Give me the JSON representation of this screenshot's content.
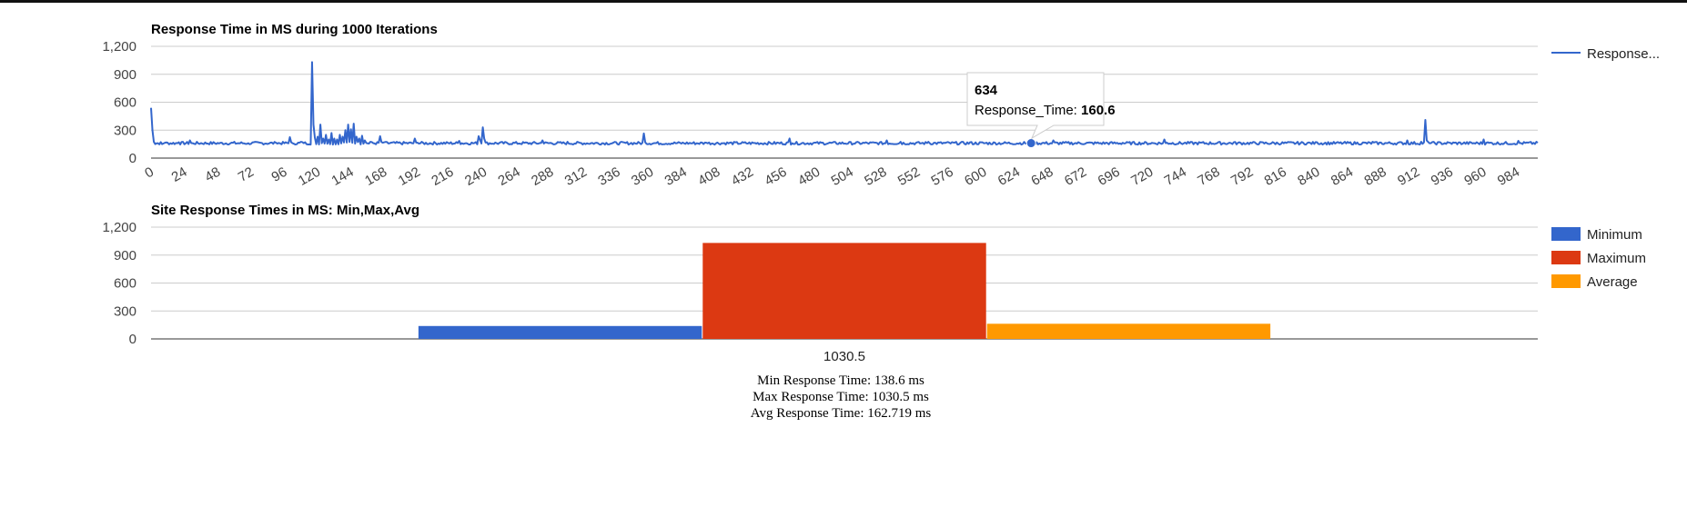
{
  "chart_data": [
    {
      "type": "line",
      "title": "Response Time in MS during 1000 Iterations",
      "xlabel": "",
      "ylabel": "",
      "ylim": [
        0,
        1200
      ],
      "yticks": [
        "0",
        "300",
        "600",
        "900",
        "1,200"
      ],
      "xticks": [
        "0",
        "24",
        "48",
        "72",
        "96",
        "120",
        "144",
        "168",
        "192",
        "216",
        "240",
        "264",
        "288",
        "312",
        "336",
        "360",
        "384",
        "408",
        "432",
        "456",
        "480",
        "504",
        "528",
        "552",
        "576",
        "600",
        "624",
        "648",
        "672",
        "696",
        "720",
        "744",
        "768",
        "792",
        "816",
        "840",
        "864",
        "888",
        "912",
        "936",
        "960",
        "984"
      ],
      "x_range": [
        0,
        999
      ],
      "grid": true,
      "legend_position": "right",
      "series": [
        {
          "name": "Response...",
          "color": "#3366cc",
          "baseline": 160,
          "points": [
            [
              0,
              540
            ],
            [
              1,
              300
            ],
            [
              2,
              175
            ],
            [
              3,
              150
            ],
            [
              5,
              160
            ],
            [
              8,
              150
            ],
            [
              10,
              165
            ],
            [
              20,
              170
            ],
            [
              28,
              190
            ],
            [
              30,
              160
            ],
            [
              50,
              165
            ],
            [
              60,
              175
            ],
            [
              70,
              160
            ],
            [
              90,
              165
            ],
            [
              100,
              225
            ],
            [
              102,
              160
            ],
            [
              108,
              175
            ],
            [
              110,
              160
            ],
            [
              116,
              1030
            ],
            [
              117,
              360
            ],
            [
              118,
              220
            ],
            [
              120,
              230
            ],
            [
              122,
              360
            ],
            [
              124,
              210
            ],
            [
              126,
              250
            ],
            [
              128,
              200
            ],
            [
              130,
              270
            ],
            [
              132,
              210
            ],
            [
              134,
              200
            ],
            [
              136,
              250
            ],
            [
              138,
              230
            ],
            [
              140,
              300
            ],
            [
              142,
              360
            ],
            [
              144,
              310
            ],
            [
              146,
              370
            ],
            [
              148,
              230
            ],
            [
              150,
              210
            ],
            [
              152,
              240
            ],
            [
              154,
              190
            ],
            [
              158,
              175
            ],
            [
              165,
              235
            ],
            [
              168,
              170
            ],
            [
              190,
              210
            ],
            [
              192,
              165
            ],
            [
              222,
              185
            ],
            [
              236,
              235
            ],
            [
              237,
              195
            ],
            [
              239,
              330
            ],
            [
              240,
              210
            ],
            [
              242,
              170
            ],
            [
              282,
              190
            ],
            [
              300,
              175
            ],
            [
              355,
              265
            ],
            [
              356,
              170
            ],
            [
              400,
              165
            ],
            [
              460,
              210
            ],
            [
              462,
              160
            ],
            [
              530,
              190
            ],
            [
              540,
              175
            ],
            [
              560,
              175
            ],
            [
              590,
              170
            ],
            [
              634,
              160.6
            ],
            [
              650,
              190
            ],
            [
              700,
              165
            ],
            [
              730,
              200
            ],
            [
              732,
              165
            ],
            [
              780,
              170
            ],
            [
              840,
              170
            ],
            [
              880,
              175
            ],
            [
              905,
              190
            ],
            [
              915,
              175
            ],
            [
              918,
              410
            ],
            [
              919,
              190
            ],
            [
              921,
              160
            ],
            [
              960,
              200
            ],
            [
              962,
              165
            ],
            [
              985,
              185
            ],
            [
              999,
              165
            ]
          ]
        }
      ],
      "tooltip": {
        "x_label": "634",
        "series_label": "Response_Time:",
        "value": "160.6",
        "point_x": 634,
        "point_y": 160.6
      }
    },
    {
      "type": "bar",
      "title": "Site Response Times in MS: Min,Max,Avg",
      "xlabel": "",
      "ylabel": "",
      "ylim": [
        0,
        1200
      ],
      "yticks": [
        "0",
        "300",
        "600",
        "900",
        "1,200"
      ],
      "categories": [
        "1030.5"
      ],
      "grid": true,
      "legend_position": "right",
      "series": [
        {
          "name": "Minimum",
          "color": "#3366cc",
          "values": [
            138.6
          ]
        },
        {
          "name": "Maximum",
          "color": "#dc3912",
          "values": [
            1030.5
          ]
        },
        {
          "name": "Average",
          "color": "#ff9900",
          "values": [
            162.719
          ]
        }
      ]
    }
  ],
  "stats": {
    "min": "Min Response Time: 138.6 ms",
    "max": "Max Response Time: 1030.5 ms",
    "avg": "Avg Response Time: 162.719 ms"
  }
}
